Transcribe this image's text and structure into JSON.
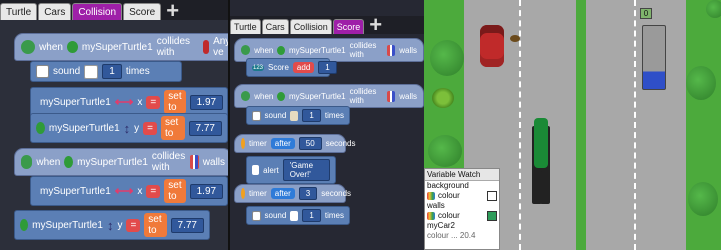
{
  "left_panel": {
    "tabs": [
      "Turtle",
      "Cars",
      "Collision",
      "Score"
    ],
    "active_tab": "Collision",
    "blocks": {
      "b1_when": "when",
      "b1_sprite": "mySuperTurtle1",
      "b1_collides": "collides with",
      "b1_target": "Any ve",
      "b1_sound": "sound",
      "b1_sound_count": "1",
      "b1_times": "times",
      "b1_set1_sprite": "mySuperTurtle1",
      "b1_set1_axis": "x",
      "b1_set1_op": "=",
      "b1_set1_set": "set to",
      "b1_set1_val": "1.97",
      "b1_set2_sprite": "mySuperTurtle1",
      "b1_set2_axis": "y",
      "b1_set2_op": "=",
      "b1_set2_set": "set to",
      "b1_set2_val": "7.77",
      "b2_when": "when",
      "b2_sprite": "mySuperTurtle1",
      "b2_collides": "collides with",
      "b2_target": "walls",
      "b2_set1_sprite": "mySuperTurtle1",
      "b2_set1_axis": "x",
      "b2_set1_op": "=",
      "b2_set1_set": "set to",
      "b2_set1_val": "1.97",
      "b3_sprite": "mySuperTurtle1",
      "b3_axis": "y",
      "b3_op": "=",
      "b3_set": "set to",
      "b3_val": "7.77"
    }
  },
  "mid_panel": {
    "tabs": [
      "Turtle",
      "Cars",
      "Collision",
      "Score"
    ],
    "active_tab": "Score",
    "blocks": {
      "m1_when": "when",
      "m1_sprite": "mySuperTurtle1",
      "m1_collides": "collides with",
      "m1_target": "walls",
      "m1_score_badge": "123",
      "m1_score": "Score",
      "m1_add": "add",
      "m1_add_val": "1",
      "m2_when": "when",
      "m2_sprite": "mySuperTurtle1",
      "m2_collides": "collides with",
      "m2_target": "walls",
      "m2_sound": "sound",
      "m2_count": "1",
      "m2_times": "times",
      "m3_timer": "timer",
      "m3_after": "after",
      "m3_val": "50",
      "m3_seconds": "seconds",
      "m3_alert": "alert",
      "m3_msg": "'Game Over!'",
      "m4_timer": "timer",
      "m4_after": "after",
      "m4_val": "3",
      "m4_seconds": "seconds",
      "m4_sound": "sound",
      "m4_count": "1",
      "m4_times": "times"
    }
  },
  "game": {
    "score_box": "0",
    "watch_title": "Variable Watch",
    "watch_rows": [
      "background",
      "colour",
      "walls",
      "colour",
      "myCar2"
    ],
    "watch_last": "colour ... 20.4"
  },
  "colors": {
    "active_tab": "#9e1fa8",
    "block_blue": "#5b7fb5",
    "grass": "#4caa3c",
    "road": "#a8a8a8",
    "swatch_background": "#111111",
    "swatch_walls": "#2e9c5a"
  }
}
